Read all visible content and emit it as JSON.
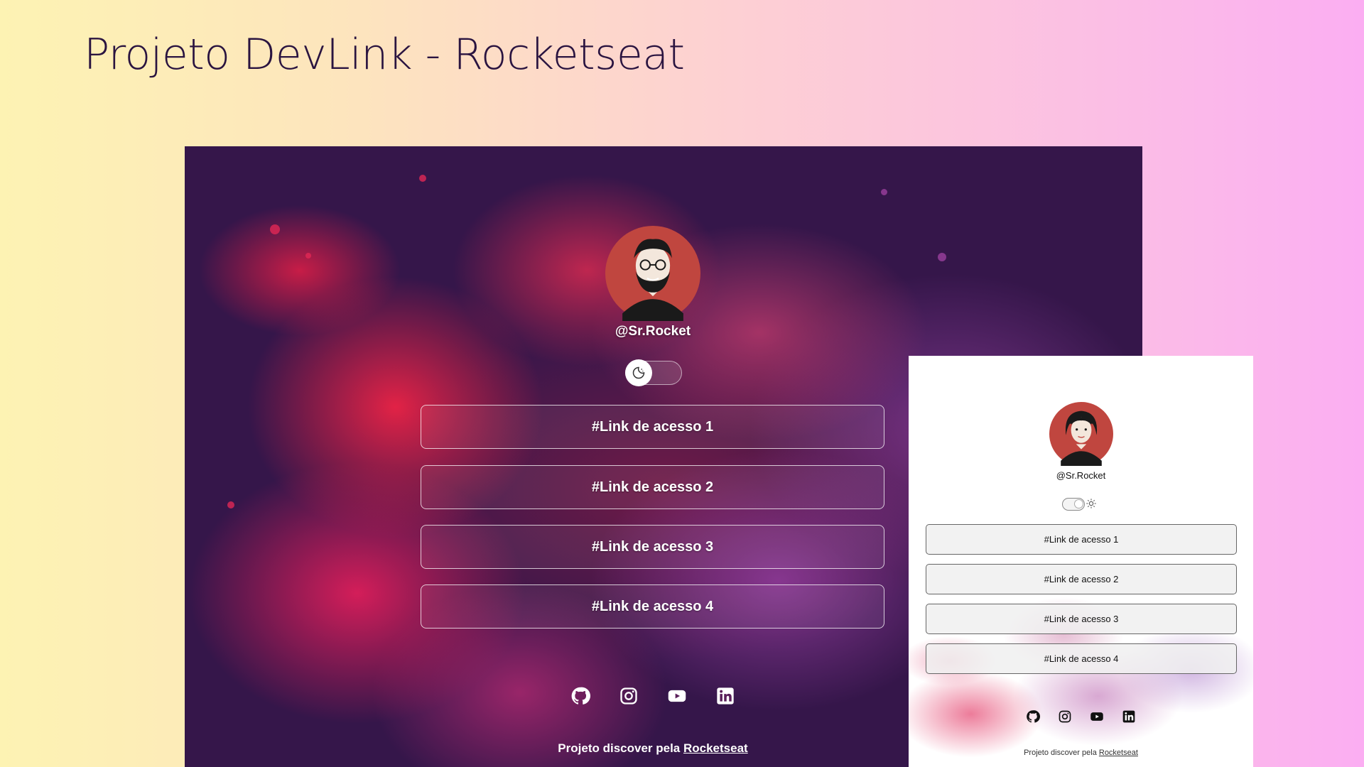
{
  "page": {
    "title": "Projeto DevLink - Rocketseat"
  },
  "dark_preview": {
    "handle": "@Sr.Rocket",
    "toggle_icon": "moon-icon",
    "links": [
      "#Link de acesso 1",
      "#Link de acesso 2",
      "#Link de acesso 3",
      "#Link de acesso 4"
    ],
    "social": [
      "github-icon",
      "instagram-icon",
      "youtube-icon",
      "linkedin-icon"
    ],
    "footer_text": "Projeto discover pela ",
    "footer_link": "Rocketseat"
  },
  "light_preview": {
    "handle": "@Sr.Rocket",
    "toggle_icon": "sun-icon",
    "links": [
      "#Link de acesso 1",
      "#Link de acesso 2",
      "#Link de acesso 3",
      "#Link de acesso 4"
    ],
    "social": [
      "github-icon",
      "instagram-icon",
      "youtube-icon",
      "linkedin-icon"
    ],
    "footer_text": "Projeto discover pela ",
    "footer_link": "Rocketseat"
  },
  "colors": {
    "background_start": "#fdf3b3",
    "background_end": "#fbaef2",
    "dark_bg": "#35164a",
    "avatar_red": "#c0463f",
    "title_text": "#2a1440"
  }
}
